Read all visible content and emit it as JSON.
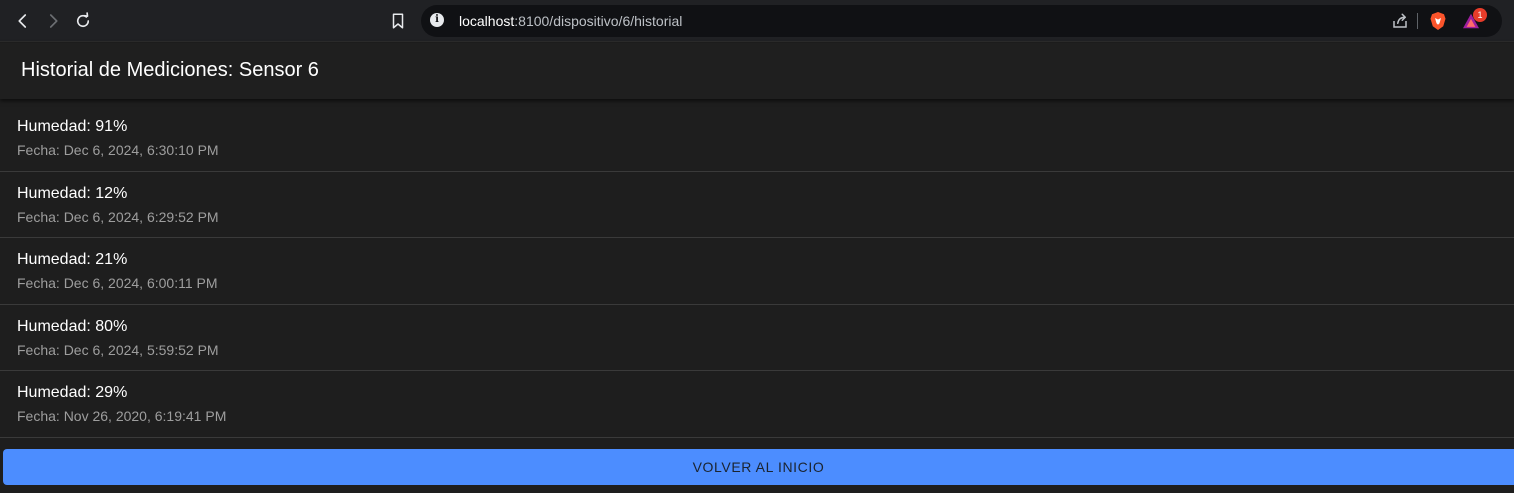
{
  "browser": {
    "url_host": "localhost",
    "url_rest": ":8100/dispositivo/6/historial",
    "rewards_badge": "1"
  },
  "header": {
    "title": "Historial de Mediciones: Sensor 6"
  },
  "measurements": [
    {
      "title": "Humedad: 91%",
      "date": "Fecha: Dec 6, 2024, 6:30:10 PM"
    },
    {
      "title": "Humedad: 12%",
      "date": "Fecha: Dec 6, 2024, 6:29:52 PM"
    },
    {
      "title": "Humedad: 21%",
      "date": "Fecha: Dec 6, 2024, 6:00:11 PM"
    },
    {
      "title": "Humedad: 80%",
      "date": "Fecha: Dec 6, 2024, 5:59:52 PM"
    },
    {
      "title": "Humedad: 29%",
      "date": "Fecha: Nov 26, 2020, 6:19:41 PM"
    }
  ],
  "footer": {
    "button_label": "VOLVER AL INICIO"
  },
  "colors": {
    "primary": "#4c8dff",
    "background": "#1e1e1e",
    "badge": "#e83c2a"
  }
}
